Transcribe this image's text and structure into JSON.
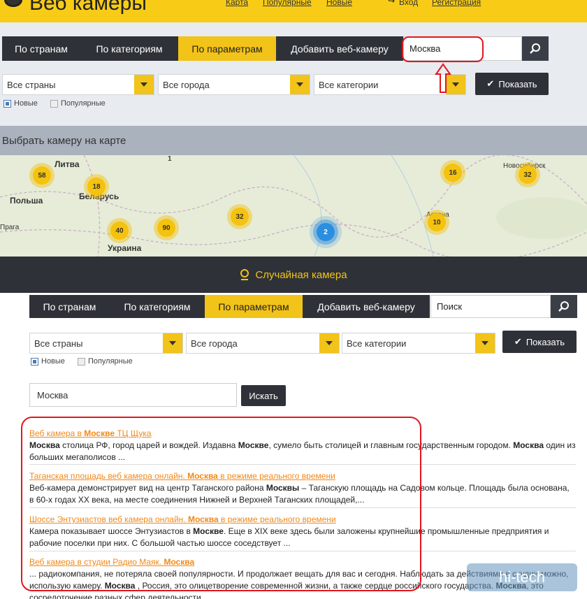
{
  "header": {
    "logo_text": "Веб камеры",
    "links": [
      "Карта",
      "Популярные",
      "Новые"
    ],
    "login": "Вход",
    "register": "Регистрация"
  },
  "nav": {
    "items": [
      "По странам",
      "По категориям",
      "По параметрам",
      "Добавить веб-камеру"
    ],
    "active_index": 2
  },
  "search_top": {
    "value": "Москва"
  },
  "filters": {
    "countries": "Все страны",
    "cities": "Все города",
    "categories": "Все категории",
    "show_label": "Показать",
    "check_new": "Новые",
    "check_popular": "Популярные"
  },
  "map": {
    "title": "Выбрать камеру на карте",
    "clusters": [
      "58",
      "18",
      "40",
      "90",
      "32",
      "2",
      "16",
      "10",
      "32",
      "1"
    ],
    "labels": [
      "Литва",
      "Беларусь",
      "Польша",
      "Украина",
      "Новосибирск",
      "Астана",
      "Прага"
    ]
  },
  "random_camera": {
    "label": "Случайная камера"
  },
  "search_bottom": {
    "placeholder": "Поиск"
  },
  "query": {
    "value": "Москва",
    "button": "Искать"
  },
  "results": [
    {
      "title_pre": "Веб камера в ",
      "title_bold": "Москве",
      "title_post": " ТЦ Щука",
      "snippet_html_parts": [
        {
          "b": "Москва"
        },
        {
          "t": " столица РФ, город царей и вождей. Издавна "
        },
        {
          "b": "Москве"
        },
        {
          "t": ", сумело быть столицей и главным государственным городом. "
        },
        {
          "b": "Москва"
        },
        {
          "t": " один из больших мегаполисов ..."
        }
      ]
    },
    {
      "title_pre": "Таганская площадь веб камера онлайн. ",
      "title_bold": "Москва",
      "title_post": " в режиме реального времени",
      "snippet_html_parts": [
        {
          "t": "Веб-камера демонстрирует вид на центр Таганского района "
        },
        {
          "b": "Москвы"
        },
        {
          "t": " – Таганскую площадь на Садовом кольце. Площадь была основана, в 60-х годах XX века, на месте соединения Нижней и Верхней Таганских площадей,..."
        }
      ]
    },
    {
      "title_pre": "Шоссе Энтузиастов веб камера онлайн. ",
      "title_bold": "Москва",
      "title_post": " в режиме реального времени",
      "snippet_html_parts": [
        {
          "t": "Камера показывает шоссе Энтузиастов в "
        },
        {
          "b": "Москве"
        },
        {
          "t": ". Еще в XIX веке здесь были заложены крупнейшие промышленные предприятия и рабочие поселки при них. С большой частью шоссе соседствует ..."
        }
      ]
    },
    {
      "title_pre": "Веб камера в студии Радио Маяк. ",
      "title_bold": "Москва",
      "title_post": "",
      "snippet_html_parts": [
        {
          "t": "... радиокомпания, не потеряла своей популярности. И продолжает вещать для вас и сегодня. Наблюдать за действиями в студии можно, использую камеру. "
        },
        {
          "b": "Москва"
        },
        {
          "t": " , Россия, это олицетворение современной жизни, а также сердце российского государства. "
        },
        {
          "b": "Москва"
        },
        {
          "t": ", это сосредоточение разных сфер деятельности..."
        }
      ]
    }
  ],
  "watermark": "hi-tech",
  "colors": {
    "accent": "#f2c318",
    "dark": "#2e3238",
    "link": "#f0891a",
    "annotation": "#e3161d"
  }
}
